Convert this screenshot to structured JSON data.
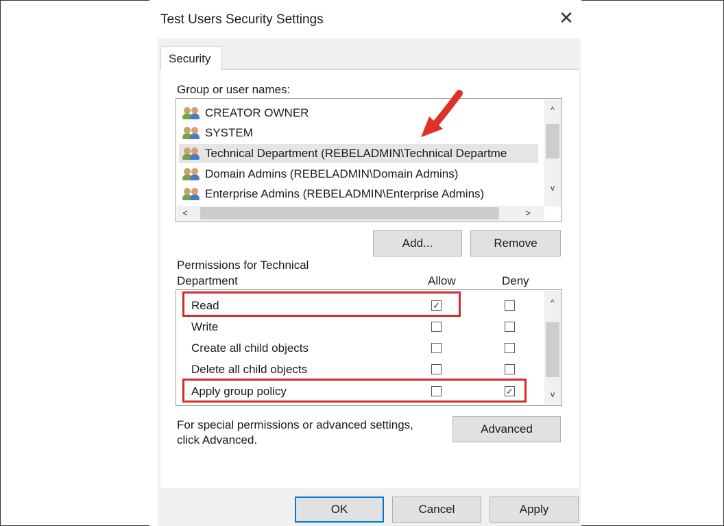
{
  "dialog": {
    "title": "Test Users Security Settings",
    "close_symbol": "✕",
    "tab_label": "Security"
  },
  "group_list": {
    "label": "Group or user names:",
    "items": [
      {
        "name": "CREATOR OWNER",
        "selected": false
      },
      {
        "name": "SYSTEM",
        "selected": false
      },
      {
        "name": "Technical Department (REBELADMIN\\Technical Departme",
        "selected": true
      },
      {
        "name": "Domain Admins (REBELADMIN\\Domain Admins)",
        "selected": false
      },
      {
        "name": "Enterprise Admins (REBELADMIN\\Enterprise Admins)",
        "selected": false
      }
    ],
    "scroll_up": "^",
    "scroll_down": "v",
    "scroll_left": "<",
    "scroll_right": ">"
  },
  "buttons": {
    "add": "Add...",
    "remove": "Remove",
    "advanced": "Advanced",
    "ok": "OK",
    "cancel": "Cancel",
    "apply": "Apply"
  },
  "permissions": {
    "label_line1": "Permissions for Technical",
    "label_line2": "Department",
    "allow_header": "Allow",
    "deny_header": "Deny",
    "rows": [
      {
        "name": "Read",
        "allow": true,
        "deny": false,
        "highlighted": true
      },
      {
        "name": "Write",
        "allow": false,
        "deny": false,
        "highlighted": false
      },
      {
        "name": "Create all child objects",
        "allow": false,
        "deny": false,
        "highlighted": false
      },
      {
        "name": "Delete all child objects",
        "allow": false,
        "deny": false,
        "highlighted": false
      },
      {
        "name": "Apply group policy",
        "allow": false,
        "deny": true,
        "highlighted": true
      }
    ],
    "check_mark": "✓"
  },
  "advanced_note": {
    "line1": "For special permissions or advanced settings,",
    "line2": "click Advanced."
  },
  "colors": {
    "highlight": "#d42b2b",
    "arrow": "#e0302a",
    "primary_button_border": "#0078d7"
  }
}
